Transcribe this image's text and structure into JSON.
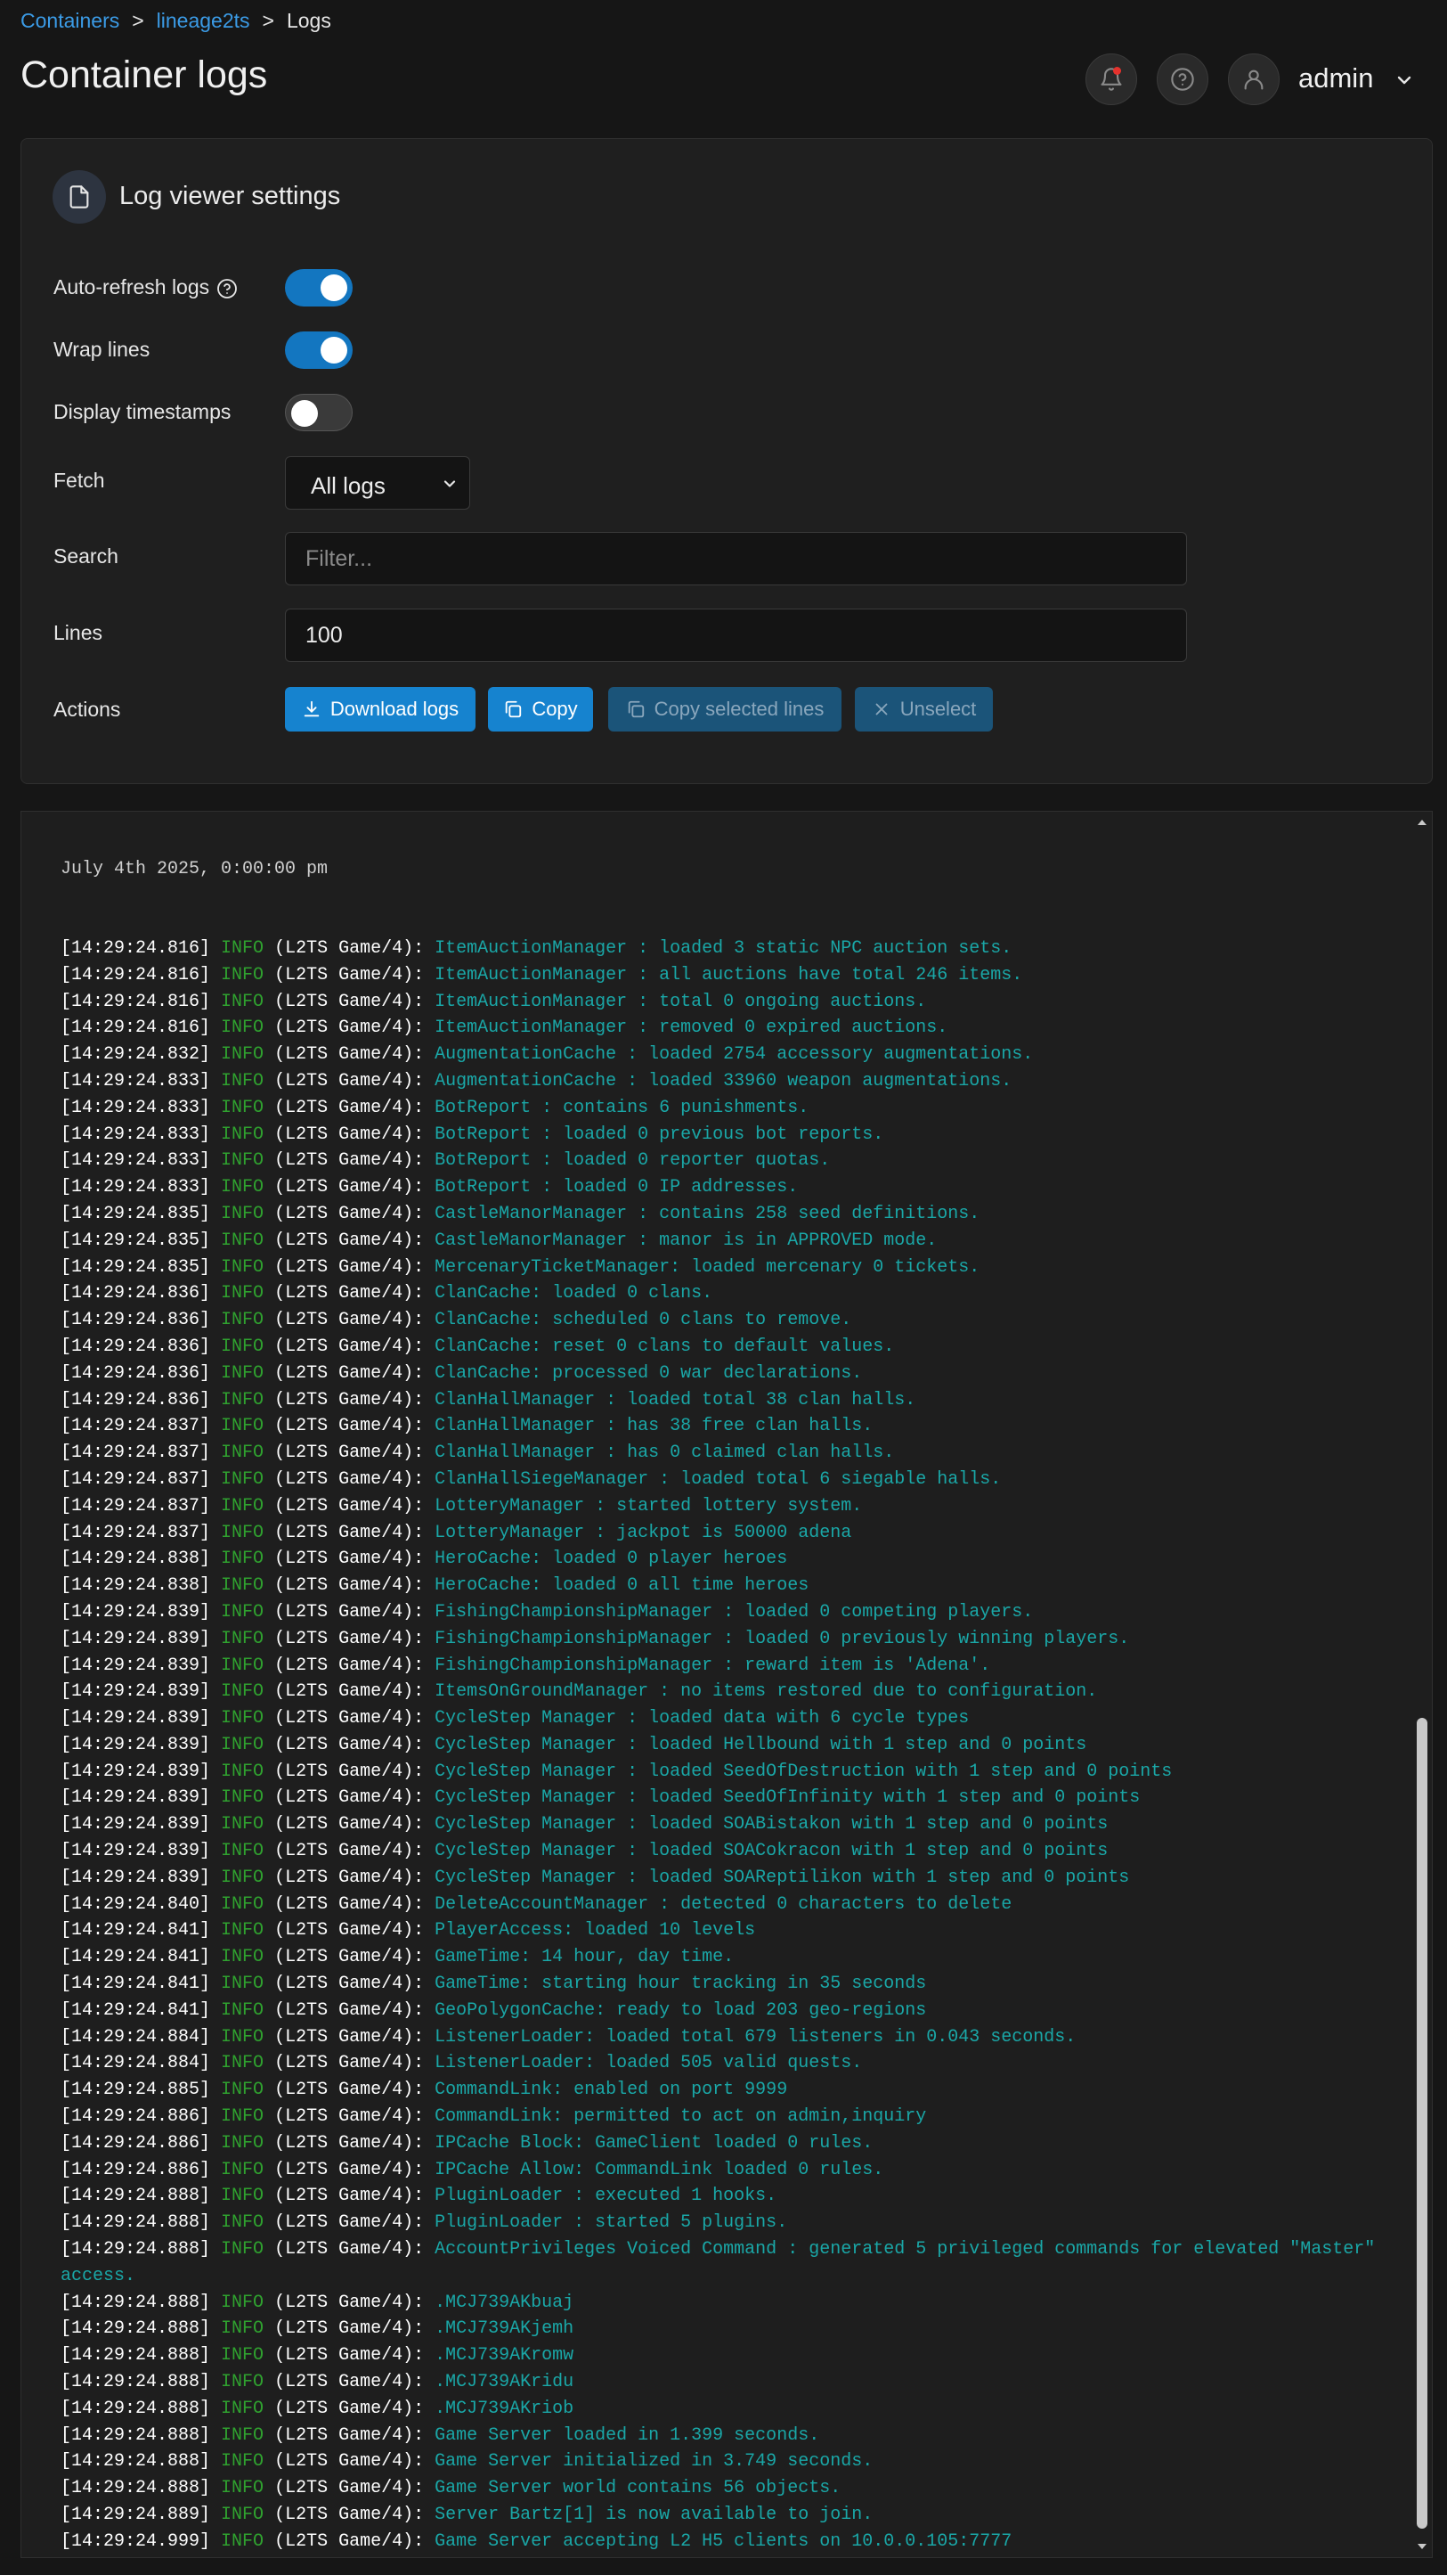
{
  "breadcrumb": {
    "items": [
      "Containers",
      "lineage2ts",
      "Logs"
    ],
    "separator": ">"
  },
  "page": {
    "title": "Container logs"
  },
  "header": {
    "user_name": "admin",
    "icons": [
      "bell-icon",
      "help-icon",
      "user-icon",
      "chevron-down-icon"
    ]
  },
  "settings": {
    "title": "Log viewer settings",
    "auto_refresh": {
      "label": "Auto-refresh logs",
      "enabled": true
    },
    "wrap_lines": {
      "label": "Wrap lines",
      "enabled": true
    },
    "display_timestamps": {
      "label": "Display timestamps",
      "enabled": false
    },
    "fetch": {
      "label": "Fetch",
      "value": "All logs"
    },
    "search": {
      "label": "Search",
      "value": "",
      "placeholder": "Filter..."
    },
    "lines": {
      "label": "Lines",
      "value": "100"
    },
    "actions": {
      "label": "Actions",
      "download": "Download logs",
      "copy": "Copy",
      "copy_selected": "Copy selected lines",
      "unselect": "Unselect"
    }
  },
  "colors": {
    "accent": "#1683cf",
    "log_timestamp": "#ffffff",
    "log_level": "#2fa12f",
    "log_message": "#1aa7a7"
  },
  "logs": {
    "date_separator": "July 4th 2025, 0:00:00 pm",
    "lines": [
      {
        "ts": "[14:29:24.816]",
        "lvl": "INFO",
        "src": "(L2TS Game/4):",
        "msg": "ItemAuctionManager : loaded 3 static NPC auction sets."
      },
      {
        "ts": "[14:29:24.816]",
        "lvl": "INFO",
        "src": "(L2TS Game/4):",
        "msg": "ItemAuctionManager : all auctions have total 246 items."
      },
      {
        "ts": "[14:29:24.816]",
        "lvl": "INFO",
        "src": "(L2TS Game/4):",
        "msg": "ItemAuctionManager : total 0 ongoing auctions."
      },
      {
        "ts": "[14:29:24.816]",
        "lvl": "INFO",
        "src": "(L2TS Game/4):",
        "msg": "ItemAuctionManager : removed 0 expired auctions."
      },
      {
        "ts": "[14:29:24.832]",
        "lvl": "INFO",
        "src": "(L2TS Game/4):",
        "msg": "AugmentationCache : loaded 2754 accessory augmentations."
      },
      {
        "ts": "[14:29:24.833]",
        "lvl": "INFO",
        "src": "(L2TS Game/4):",
        "msg": "AugmentationCache : loaded 33960 weapon augmentations."
      },
      {
        "ts": "[14:29:24.833]",
        "lvl": "INFO",
        "src": "(L2TS Game/4):",
        "msg": "BotReport : contains 6 punishments."
      },
      {
        "ts": "[14:29:24.833]",
        "lvl": "INFO",
        "src": "(L2TS Game/4):",
        "msg": "BotReport : loaded 0 previous bot reports."
      },
      {
        "ts": "[14:29:24.833]",
        "lvl": "INFO",
        "src": "(L2TS Game/4):",
        "msg": "BotReport : loaded 0 reporter quotas."
      },
      {
        "ts": "[14:29:24.833]",
        "lvl": "INFO",
        "src": "(L2TS Game/4):",
        "msg": "BotReport : loaded 0 IP addresses."
      },
      {
        "ts": "[14:29:24.835]",
        "lvl": "INFO",
        "src": "(L2TS Game/4):",
        "msg": "CastleManorManager : contains 258 seed definitions."
      },
      {
        "ts": "[14:29:24.835]",
        "lvl": "INFO",
        "src": "(L2TS Game/4):",
        "msg": "CastleManorManager : manor is in APPROVED mode."
      },
      {
        "ts": "[14:29:24.835]",
        "lvl": "INFO",
        "src": "(L2TS Game/4):",
        "msg": "MercenaryTicketManager: loaded mercenary 0 tickets."
      },
      {
        "ts": "[14:29:24.836]",
        "lvl": "INFO",
        "src": "(L2TS Game/4):",
        "msg": "ClanCache: loaded 0 clans."
      },
      {
        "ts": "[14:29:24.836]",
        "lvl": "INFO",
        "src": "(L2TS Game/4):",
        "msg": "ClanCache: scheduled 0 clans to remove."
      },
      {
        "ts": "[14:29:24.836]",
        "lvl": "INFO",
        "src": "(L2TS Game/4):",
        "msg": "ClanCache: reset 0 clans to default values."
      },
      {
        "ts": "[14:29:24.836]",
        "lvl": "INFO",
        "src": "(L2TS Game/4):",
        "msg": "ClanCache: processed 0 war declarations."
      },
      {
        "ts": "[14:29:24.836]",
        "lvl": "INFO",
        "src": "(L2TS Game/4):",
        "msg": "ClanHallManager : loaded total 38 clan halls."
      },
      {
        "ts": "[14:29:24.837]",
        "lvl": "INFO",
        "src": "(L2TS Game/4):",
        "msg": "ClanHallManager : has 38 free clan halls."
      },
      {
        "ts": "[14:29:24.837]",
        "lvl": "INFO",
        "src": "(L2TS Game/4):",
        "msg": "ClanHallManager : has 0 claimed clan halls."
      },
      {
        "ts": "[14:29:24.837]",
        "lvl": "INFO",
        "src": "(L2TS Game/4):",
        "msg": "ClanHallSiegeManager : loaded total 6 siegable halls."
      },
      {
        "ts": "[14:29:24.837]",
        "lvl": "INFO",
        "src": "(L2TS Game/4):",
        "msg": "LotteryManager : started lottery system."
      },
      {
        "ts": "[14:29:24.837]",
        "lvl": "INFO",
        "src": "(L2TS Game/4):",
        "msg": "LotteryManager : jackpot is 50000 adena"
      },
      {
        "ts": "[14:29:24.838]",
        "lvl": "INFO",
        "src": "(L2TS Game/4):",
        "msg": "HeroCache: loaded 0 player heroes"
      },
      {
        "ts": "[14:29:24.838]",
        "lvl": "INFO",
        "src": "(L2TS Game/4):",
        "msg": "HeroCache: loaded 0 all time heroes"
      },
      {
        "ts": "[14:29:24.839]",
        "lvl": "INFO",
        "src": "(L2TS Game/4):",
        "msg": "FishingChampionshipManager : loaded 0 competing players."
      },
      {
        "ts": "[14:29:24.839]",
        "lvl": "INFO",
        "src": "(L2TS Game/4):",
        "msg": "FishingChampionshipManager : loaded 0 previously winning players."
      },
      {
        "ts": "[14:29:24.839]",
        "lvl": "INFO",
        "src": "(L2TS Game/4):",
        "msg": "FishingChampionshipManager : reward item is 'Adena'."
      },
      {
        "ts": "[14:29:24.839]",
        "lvl": "INFO",
        "src": "(L2TS Game/4):",
        "msg": "ItemsOnGroundManager : no items restored due to configuration."
      },
      {
        "ts": "[14:29:24.839]",
        "lvl": "INFO",
        "src": "(L2TS Game/4):",
        "msg": "CycleStep Manager : loaded data with 6 cycle types"
      },
      {
        "ts": "[14:29:24.839]",
        "lvl": "INFO",
        "src": "(L2TS Game/4):",
        "msg": "CycleStep Manager : loaded Hellbound with 1 step and 0 points"
      },
      {
        "ts": "[14:29:24.839]",
        "lvl": "INFO",
        "src": "(L2TS Game/4):",
        "msg": "CycleStep Manager : loaded SeedOfDestruction with 1 step and 0 points"
      },
      {
        "ts": "[14:29:24.839]",
        "lvl": "INFO",
        "src": "(L2TS Game/4):",
        "msg": "CycleStep Manager : loaded SeedOfInfinity with 1 step and 0 points"
      },
      {
        "ts": "[14:29:24.839]",
        "lvl": "INFO",
        "src": "(L2TS Game/4):",
        "msg": "CycleStep Manager : loaded SOABistakon with 1 step and 0 points"
      },
      {
        "ts": "[14:29:24.839]",
        "lvl": "INFO",
        "src": "(L2TS Game/4):",
        "msg": "CycleStep Manager : loaded SOACokracon with 1 step and 0 points"
      },
      {
        "ts": "[14:29:24.839]",
        "lvl": "INFO",
        "src": "(L2TS Game/4):",
        "msg": "CycleStep Manager : loaded SOAReptilikon with 1 step and 0 points"
      },
      {
        "ts": "[14:29:24.840]",
        "lvl": "INFO",
        "src": "(L2TS Game/4):",
        "msg": "DeleteAccountManager : detected 0 characters to delete"
      },
      {
        "ts": "[14:29:24.841]",
        "lvl": "INFO",
        "src": "(L2TS Game/4):",
        "msg": "PlayerAccess: loaded 10 levels"
      },
      {
        "ts": "[14:29:24.841]",
        "lvl": "INFO",
        "src": "(L2TS Game/4):",
        "msg": "GameTime: 14 hour, day time."
      },
      {
        "ts": "[14:29:24.841]",
        "lvl": "INFO",
        "src": "(L2TS Game/4):",
        "msg": "GameTime: starting hour tracking in 35 seconds"
      },
      {
        "ts": "[14:29:24.841]",
        "lvl": "INFO",
        "src": "(L2TS Game/4):",
        "msg": "GeoPolygonCache: ready to load 203 geo-regions"
      },
      {
        "ts": "[14:29:24.884]",
        "lvl": "INFO",
        "src": "(L2TS Game/4):",
        "msg": "ListenerLoader: loaded total 679 listeners in 0.043 seconds."
      },
      {
        "ts": "[14:29:24.884]",
        "lvl": "INFO",
        "src": "(L2TS Game/4):",
        "msg": "ListenerLoader: loaded 505 valid quests."
      },
      {
        "ts": "[14:29:24.885]",
        "lvl": "INFO",
        "src": "(L2TS Game/4):",
        "msg": "CommandLink: enabled on port 9999"
      },
      {
        "ts": "[14:29:24.886]",
        "lvl": "INFO",
        "src": "(L2TS Game/4):",
        "msg": "CommandLink: permitted to act on admin,inquiry"
      },
      {
        "ts": "[14:29:24.886]",
        "lvl": "INFO",
        "src": "(L2TS Game/4):",
        "msg": "IPCache Block: GameClient loaded 0 rules."
      },
      {
        "ts": "[14:29:24.886]",
        "lvl": "INFO",
        "src": "(L2TS Game/4):",
        "msg": "IPCache Allow: CommandLink loaded 0 rules."
      },
      {
        "ts": "[14:29:24.888]",
        "lvl": "INFO",
        "src": "(L2TS Game/4):",
        "msg": "PluginLoader : executed 1 hooks."
      },
      {
        "ts": "[14:29:24.888]",
        "lvl": "INFO",
        "src": "(L2TS Game/4):",
        "msg": "PluginLoader : started 5 plugins."
      },
      {
        "ts": "[14:29:24.888]",
        "lvl": "INFO",
        "src": "(L2TS Game/4):",
        "msg": "AccountPrivileges Voiced Command : generated 5 privileged commands for elevated \"Master\" access."
      },
      {
        "ts": "[14:29:24.888]",
        "lvl": "INFO",
        "src": "(L2TS Game/4):",
        "msg": ".MCJ739AKbuaj"
      },
      {
        "ts": "[14:29:24.888]",
        "lvl": "INFO",
        "src": "(L2TS Game/4):",
        "msg": ".MCJ739AKjemh"
      },
      {
        "ts": "[14:29:24.888]",
        "lvl": "INFO",
        "src": "(L2TS Game/4):",
        "msg": ".MCJ739AKromw"
      },
      {
        "ts": "[14:29:24.888]",
        "lvl": "INFO",
        "src": "(L2TS Game/4):",
        "msg": ".MCJ739AKridu"
      },
      {
        "ts": "[14:29:24.888]",
        "lvl": "INFO",
        "src": "(L2TS Game/4):",
        "msg": ".MCJ739AKriob"
      },
      {
        "ts": "[14:29:24.888]",
        "lvl": "INFO",
        "src": "(L2TS Game/4):",
        "msg": "Game Server loaded in 1.399 seconds."
      },
      {
        "ts": "[14:29:24.888]",
        "lvl": "INFO",
        "src": "(L2TS Game/4):",
        "msg": "Game Server initialized in 3.749 seconds."
      },
      {
        "ts": "[14:29:24.888]",
        "lvl": "INFO",
        "src": "(L2TS Game/4):",
        "msg": "Game Server world contains 56 objects."
      },
      {
        "ts": "[14:29:24.889]",
        "lvl": "INFO",
        "src": "(L2TS Game/4):",
        "msg": "Server Bartz[1] is now available to join."
      },
      {
        "ts": "[14:29:24.999]",
        "lvl": "INFO",
        "src": "(L2TS Game/4):",
        "msg": "Game Server accepting L2 H5 clients on 10.0.0.105:7777"
      }
    ]
  }
}
